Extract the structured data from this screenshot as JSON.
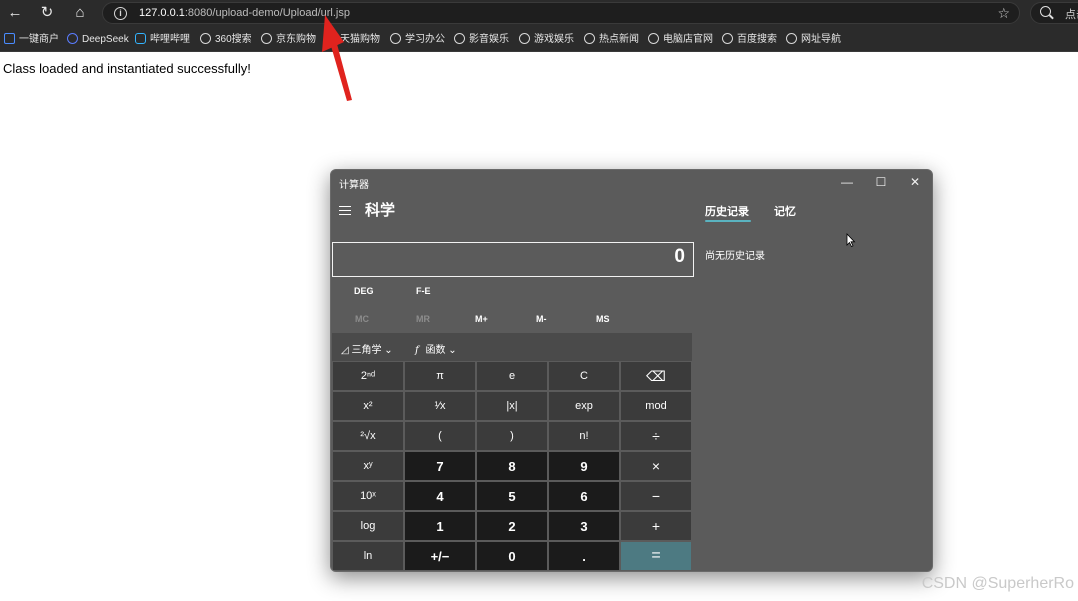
{
  "browser": {
    "url_host": "127.0.0.1",
    "url_rest": ":8080/upload-demo/Upload/url.jsp",
    "search_label": "点击"
  },
  "bookmarks": [
    {
      "label": "一键商户"
    },
    {
      "label": "DeepSeek"
    },
    {
      "label": "哔哩哔哩"
    },
    {
      "label": "360搜索"
    },
    {
      "label": "京东购物"
    },
    {
      "label": "天猫购物"
    },
    {
      "label": "学习办公"
    },
    {
      "label": "影音娱乐"
    },
    {
      "label": "游戏娱乐"
    },
    {
      "label": "热点新闻"
    },
    {
      "label": "电脑店官网"
    },
    {
      "label": "百度搜索"
    },
    {
      "label": "网址导航"
    }
  ],
  "page": {
    "message": "Class loaded and instantiated successfully!"
  },
  "calculator": {
    "window_title": "计算器",
    "mode": "科学",
    "tabs": {
      "history": "历史记录",
      "memory": "记忆"
    },
    "no_history": "尚无历史记录",
    "display": "0",
    "angle": "DEG",
    "fe": "F-E",
    "memory_buttons": [
      "MC",
      "MR",
      "M+",
      "M-",
      "MS"
    ],
    "functions": {
      "trig": "三角学",
      "func": "函数"
    },
    "keys": [
      [
        "2ⁿᵈ",
        "π",
        "e",
        "C",
        "⌫"
      ],
      [
        "x²",
        "¹⁄x",
        "|x|",
        "exp",
        "mod"
      ],
      [
        "²√x",
        "(",
        ")",
        "n!",
        "÷"
      ],
      [
        "xʸ",
        "7",
        "8",
        "9",
        "×"
      ],
      [
        "10ˣ",
        "4",
        "5",
        "6",
        "−"
      ],
      [
        "log",
        "1",
        "2",
        "3",
        "+"
      ],
      [
        "ln",
        "+/−",
        "0",
        ".",
        "="
      ]
    ],
    "accent_color": "#4d7a82"
  },
  "watermark": "CSDN @SuperherRo"
}
